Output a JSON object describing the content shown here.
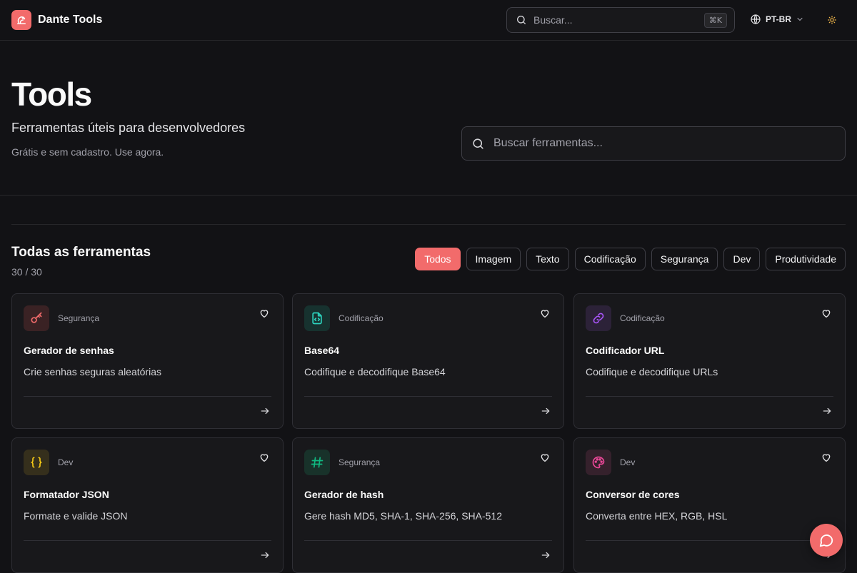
{
  "header": {
    "brand_name": "Dante Tools",
    "search_placeholder": "Buscar...",
    "search_shortcut": "⌘K",
    "language": "PT-BR"
  },
  "hero": {
    "title": "Tools",
    "subtitle": "Ferramentas úteis para desenvolvedores",
    "note": "Grátis e sem cadastro. Use agora.",
    "search_placeholder": "Buscar ferramentas..."
  },
  "section": {
    "title": "Todas as ferramentas",
    "count": "30 / 30"
  },
  "filters": [
    "Todos",
    "Imagem",
    "Texto",
    "Codificação",
    "Segurança",
    "Dev",
    "Produtividade"
  ],
  "active_filter": "Todos",
  "tools": [
    {
      "name": "Gerador de senhas",
      "category": "Segurança",
      "description": "Crie senhas seguras aleatórias",
      "icon": "key-icon",
      "color": "#f26b6b"
    },
    {
      "name": "Base64",
      "category": "Codificação",
      "description": "Codifique e decodifique Base64",
      "icon": "file-code-icon",
      "color": "#2dd4bf"
    },
    {
      "name": "Codificador URL",
      "category": "Codificação",
      "description": "Codifique e decodifique URLs",
      "icon": "link-icon",
      "color": "#a855f7"
    },
    {
      "name": "Formatador JSON",
      "category": "Dev",
      "description": "Formate e valide JSON",
      "icon": "braces-icon",
      "color": "#facc15"
    },
    {
      "name": "Gerador de hash",
      "category": "Segurança",
      "description": "Gere hash MD5, SHA-1, SHA-256, SHA-512",
      "icon": "hash-icon",
      "color": "#10b981"
    },
    {
      "name": "Conversor de cores",
      "category": "Dev",
      "description": "Converta entre HEX, RGB, HSL",
      "icon": "palette-icon",
      "color": "#ec4899"
    }
  ],
  "colors": {
    "accent": "#f26b6b",
    "background": "#121215",
    "card": "#18181b"
  }
}
